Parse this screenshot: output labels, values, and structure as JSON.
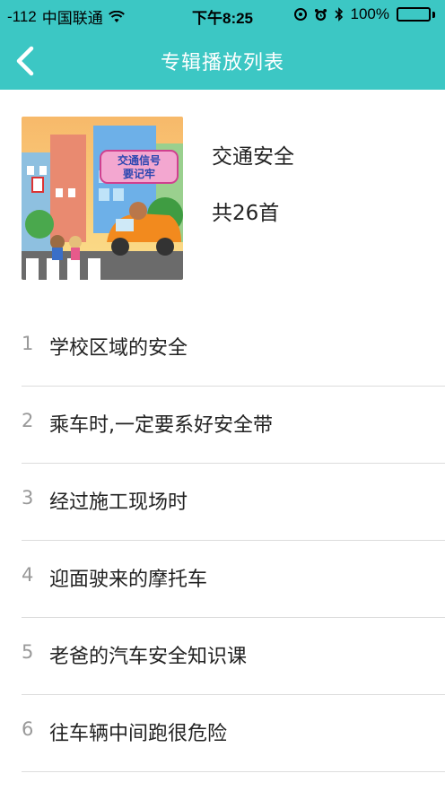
{
  "status": {
    "signal": "-112",
    "carrier": "中国联通",
    "time": "下午8:25",
    "battery": "100%"
  },
  "nav": {
    "title": "专辑播放列表"
  },
  "album": {
    "title": "交通安全",
    "count": "共26首",
    "cover_sign": "交通信号要记牢"
  },
  "tracks": [
    {
      "index": "1",
      "title": "学校区域的安全"
    },
    {
      "index": "2",
      "title": "乘车时,一定要系好安全带"
    },
    {
      "index": "3",
      "title": "经过施工现场时"
    },
    {
      "index": "4",
      "title": "迎面驶来的摩托车"
    },
    {
      "index": "5",
      "title": "老爸的汽车安全知识课"
    },
    {
      "index": "6",
      "title": "往车辆中间跑很危险"
    }
  ],
  "colors": {
    "accent": "#3cc7c4",
    "battery": "#33d05b"
  }
}
